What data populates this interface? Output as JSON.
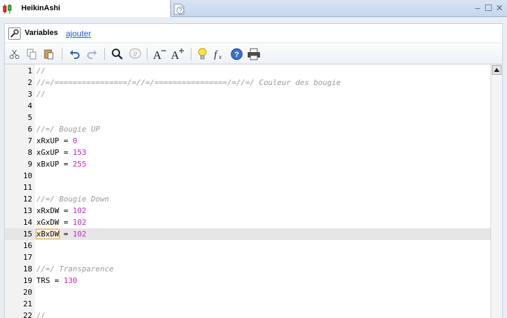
{
  "tab": {
    "title": "HeikinAshi"
  },
  "window_controls": {
    "minimize": "–",
    "maximize": "☐",
    "close": "✕"
  },
  "variables": {
    "label": "Variables",
    "add_link": "ajouter"
  },
  "toolbar": {
    "buttons": [
      "cut-icon",
      "copy-icon",
      "paste-icon",
      "undo-icon",
      "redo-icon",
      "search-icon",
      "comment-icon",
      "decrease-font-icon",
      "increase-font-icon",
      "lightbulb-icon",
      "function-icon",
      "help-icon",
      "print-icon"
    ]
  },
  "editor": {
    "current_line": 15,
    "lines": [
      {
        "n": "1",
        "parts": [
          {
            "t": "//",
            "c": "cm"
          }
        ]
      },
      {
        "n": "2",
        "parts": [
          {
            "t": "//=/================/=//=/================/=//=/ Couleur des bougie",
            "c": "cm"
          }
        ]
      },
      {
        "n": "3",
        "parts": [
          {
            "t": "//",
            "c": "cm"
          }
        ]
      },
      {
        "n": "4",
        "parts": []
      },
      {
        "n": "5",
        "parts": []
      },
      {
        "n": "6",
        "parts": [
          {
            "t": "//=/ Bougie UP",
            "c": "cm"
          }
        ]
      },
      {
        "n": "7",
        "parts": [
          {
            "t": "xRxUP",
            "c": "id"
          },
          {
            "t": " = ",
            "c": "id"
          },
          {
            "t": "0",
            "c": "num"
          }
        ]
      },
      {
        "n": "8",
        "parts": [
          {
            "t": "xGxUP",
            "c": "id"
          },
          {
            "t": " = ",
            "c": "id"
          },
          {
            "t": "153",
            "c": "num"
          }
        ]
      },
      {
        "n": "9",
        "parts": [
          {
            "t": "xBxUP",
            "c": "id"
          },
          {
            "t": " = ",
            "c": "id"
          },
          {
            "t": "255",
            "c": "num"
          }
        ]
      },
      {
        "n": "10",
        "parts": []
      },
      {
        "n": "11",
        "parts": []
      },
      {
        "n": "12",
        "parts": [
          {
            "t": "//=/ Bougie Down",
            "c": "cm"
          }
        ]
      },
      {
        "n": "13",
        "parts": [
          {
            "t": "xRxDW",
            "c": "id"
          },
          {
            "t": " = ",
            "c": "id"
          },
          {
            "t": "102",
            "c": "num"
          }
        ]
      },
      {
        "n": "14",
        "parts": [
          {
            "t": "xGxDW",
            "c": "id"
          },
          {
            "t": " = ",
            "c": "id"
          },
          {
            "t": "102",
            "c": "num"
          }
        ]
      },
      {
        "n": "15",
        "parts": [
          {
            "t": "xBxDW",
            "c": "id sel"
          },
          {
            "t": " = ",
            "c": "id"
          },
          {
            "t": "102",
            "c": "num"
          }
        ]
      },
      {
        "n": "16",
        "parts": []
      },
      {
        "n": "17",
        "parts": []
      },
      {
        "n": "18",
        "parts": [
          {
            "t": "//=/ Transparence",
            "c": "cm"
          }
        ]
      },
      {
        "n": "19",
        "parts": [
          {
            "t": "TRS",
            "c": "id"
          },
          {
            "t": " = ",
            "c": "id"
          },
          {
            "t": "130",
            "c": "num"
          }
        ]
      },
      {
        "n": "20",
        "parts": []
      },
      {
        "n": "21",
        "parts": []
      },
      {
        "n": "22",
        "parts": [
          {
            "t": "//",
            "c": "cm"
          }
        ]
      }
    ]
  },
  "colors": {
    "comment": "#9a9a9a",
    "number": "#cc22cc",
    "link": "#2255cc",
    "current_line": "#e6e6e6"
  }
}
